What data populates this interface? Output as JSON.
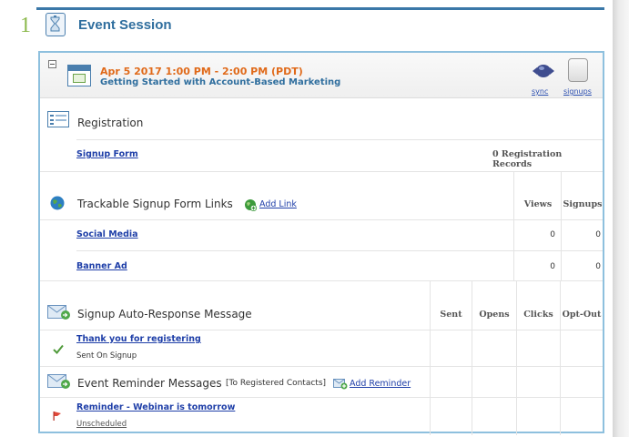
{
  "step": {
    "number": "1",
    "title": "Event Session"
  },
  "event": {
    "date_time": "Apr 5 2017 1:00 PM - 2:00 PM (PDT)",
    "name": "Getting Started with Account-Based Marketing",
    "sync_label": "sync",
    "signups_label": "signups"
  },
  "registration": {
    "title": "Registration",
    "form_link": "Signup Form",
    "records_text": "0 Registration Records"
  },
  "trackable": {
    "title": "Trackable Signup Form Links",
    "add_link_label": "Add Link",
    "columns": [
      "Views",
      "Signups"
    ],
    "rows": [
      {
        "name": "Social Media",
        "views": "0",
        "signups": "0"
      },
      {
        "name": "Banner Ad",
        "views": "0",
        "signups": "0"
      }
    ]
  },
  "auto_response": {
    "title": "Signup Auto-Response Message",
    "columns": [
      "Sent",
      "Opens",
      "Clicks",
      "Opt-Out"
    ],
    "message_link": "Thank you for registering",
    "message_status": "Sent On Signup"
  },
  "reminders": {
    "title": "Event Reminder Messages",
    "subtitle": "[To Registered Contacts]",
    "add_reminder_label": "Add Reminder",
    "message_link": "Reminder - Webinar is tomorrow",
    "message_status": "Unscheduled"
  },
  "icons": {
    "step": "hourglass-icon",
    "event": "calendar-icon",
    "sync": "sync-icon",
    "signups": "signups-icon",
    "registration": "form-icon",
    "trackable": "globe-icon",
    "add_link": "globe-add-icon",
    "auto_response": "envelope-icon",
    "sent_check": "checkmark-icon",
    "reminders": "envelope-icon",
    "add_reminder": "envelope-add-icon",
    "unscheduled": "flag-icon"
  },
  "colors": {
    "accent_blue": "#2f6e9e",
    "panel_border": "#8ec0de",
    "date_orange": "#e06a1a",
    "step_green": "#8ab84a",
    "link_blue": "#1f3fa8"
  }
}
